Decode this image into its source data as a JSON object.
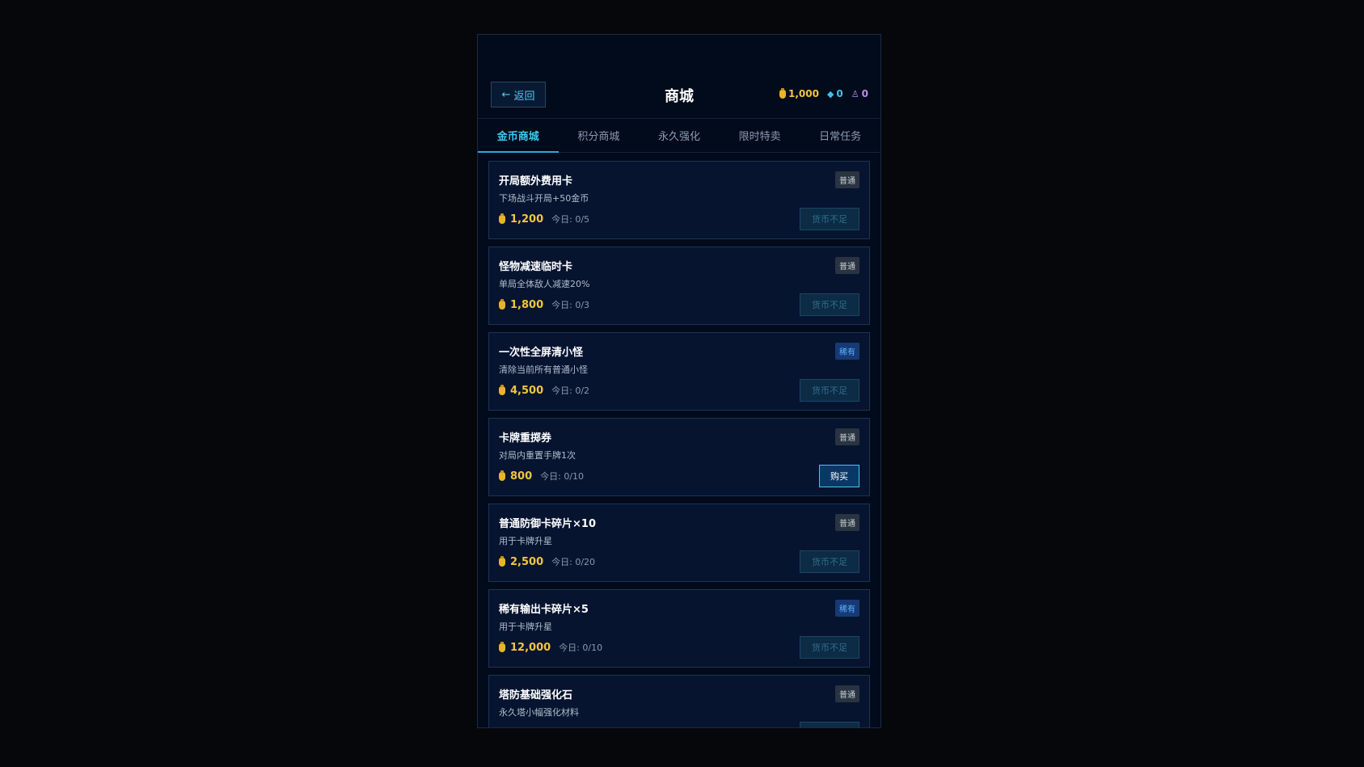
{
  "header": {
    "back_label": "返回",
    "title": "商城",
    "currencies": {
      "gold": "1,000",
      "gem": "0",
      "medal": "0"
    }
  },
  "tabs": [
    {
      "label": "金币商城",
      "active": true
    },
    {
      "label": "积分商城",
      "active": false
    },
    {
      "label": "永久强化",
      "active": false
    },
    {
      "label": "限时特卖",
      "active": false
    },
    {
      "label": "日常任务",
      "active": false
    }
  ],
  "items": [
    {
      "name": "开局额外费用卡",
      "desc": "下场战斗开局+50金币",
      "rarity": "普通",
      "price": "1,200",
      "daily": "今日: 0/5",
      "action": "货币不足"
    },
    {
      "name": "怪物减速临时卡",
      "desc": "单局全体敌人减速20%",
      "rarity": "普通",
      "price": "1,800",
      "daily": "今日: 0/3",
      "action": "货币不足"
    },
    {
      "name": "一次性全屏清小怪",
      "desc": "清除当前所有普通小怪",
      "rarity": "稀有",
      "price": "4,500",
      "daily": "今日: 0/2",
      "action": "货币不足"
    },
    {
      "name": "卡牌重掷券",
      "desc": "对局内重置手牌1次",
      "rarity": "普通",
      "price": "800",
      "daily": "今日: 0/10",
      "action": "购买"
    },
    {
      "name": "普通防御卡碎片×10",
      "desc": "用于卡牌升星",
      "rarity": "普通",
      "price": "2,500",
      "daily": "今日: 0/20",
      "action": "货币不足"
    },
    {
      "name": "稀有输出卡碎片×5",
      "desc": "用于卡牌升星",
      "rarity": "稀有",
      "price": "12,000",
      "daily": "今日: 0/10",
      "action": "货币不足"
    },
    {
      "name": "塔防基础强化石",
      "desc": "永久塔小幅强化材料",
      "rarity": "普通"
    }
  ]
}
